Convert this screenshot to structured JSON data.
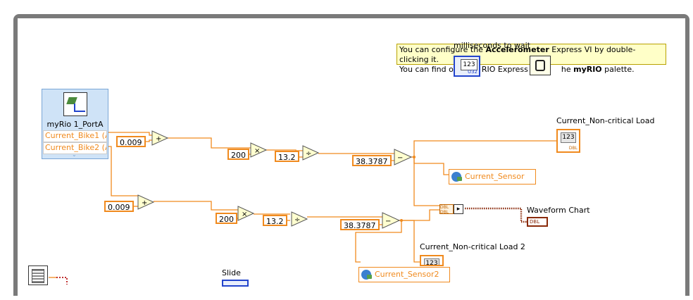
{
  "note": {
    "line1_pre": "You can configure the ",
    "line1_bold": "Accelerometer",
    "line1_post": " Express VI by double-clicking it.",
    "line2_pre": "You can find o",
    "line2_mid": "RIO Express V",
    "line2_post": "he ",
    "line2_bold": "myRIO",
    "line2_end": " palette."
  },
  "wait": {
    "label": "milliseconds to wait",
    "value": "123",
    "dtype": "U32"
  },
  "express_vi": {
    "title": "myRio 1_PortA",
    "outputs": [
      "Current_Bike1 (A",
      "Current_Bike2 (A"
    ]
  },
  "upper": {
    "offset": "0.009",
    "multiplier": "200",
    "divisor": "13.2",
    "baseline": "38.3787",
    "indicator_label": "Current_Non-critical Load",
    "indicator_value": "123",
    "indicator_dtype": "DBL",
    "sensor": "Current_Sensor"
  },
  "lower": {
    "offset": "0.009",
    "multiplier": "200",
    "divisor": "13.2",
    "baseline": "38.3787",
    "indicator_label": "Current_Non-critical Load 2",
    "indicator_value": "123",
    "sensor": "Current_Sensor2"
  },
  "waveform": {
    "label": "Waveform Chart",
    "dtype": "DBL"
  },
  "slide": {
    "label": "Slide"
  },
  "colors": {
    "wire": "#f08a1e",
    "note_bg": "#ffffc8",
    "express_bg": "#cfe3f7"
  }
}
